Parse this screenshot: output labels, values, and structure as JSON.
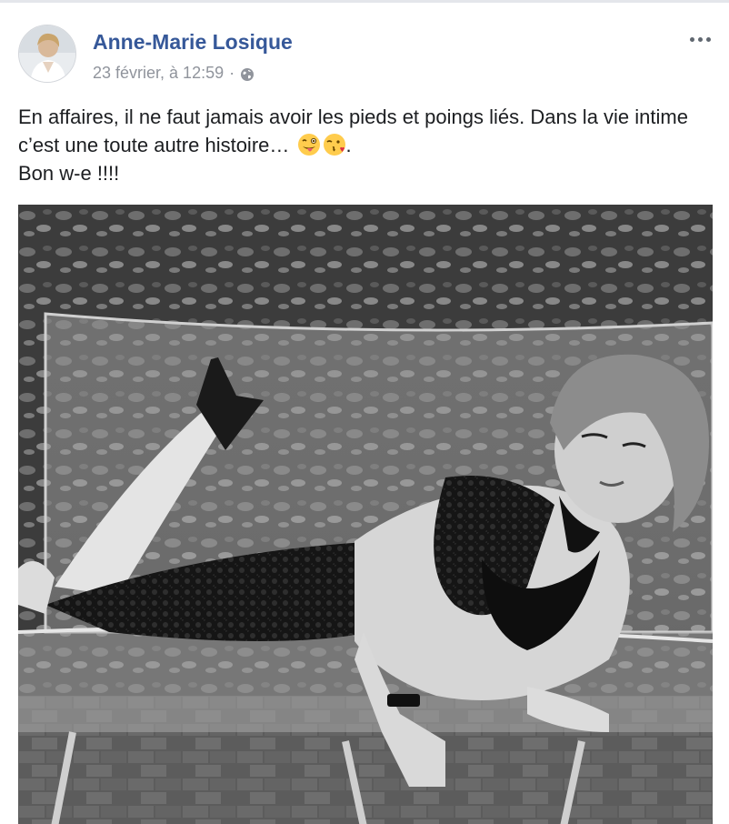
{
  "post": {
    "author": "Anne-Marie Losique",
    "date": "23 février, à 12:59",
    "separator": "·",
    "privacy_icon": "globe-icon",
    "more_icon": "more-options-icon",
    "text_line_1": "En affaires, il ne faut jamais avoir les pieds et poings liés. Dans la vie intime c’est une toute autre histoire…",
    "text_line_1_suffix": ".",
    "emojis": [
      "winking-face-with-tongue-emoji",
      "face-blowing-kiss-emoji"
    ],
    "text_line_2": "Bon w-e !!!!",
    "photo": "black-and-white-photo"
  },
  "colors": {
    "author_link": "#365899",
    "meta_text": "#90949c",
    "body_text": "#1c1e21",
    "emoji_yellow": "#ffcc4d"
  }
}
